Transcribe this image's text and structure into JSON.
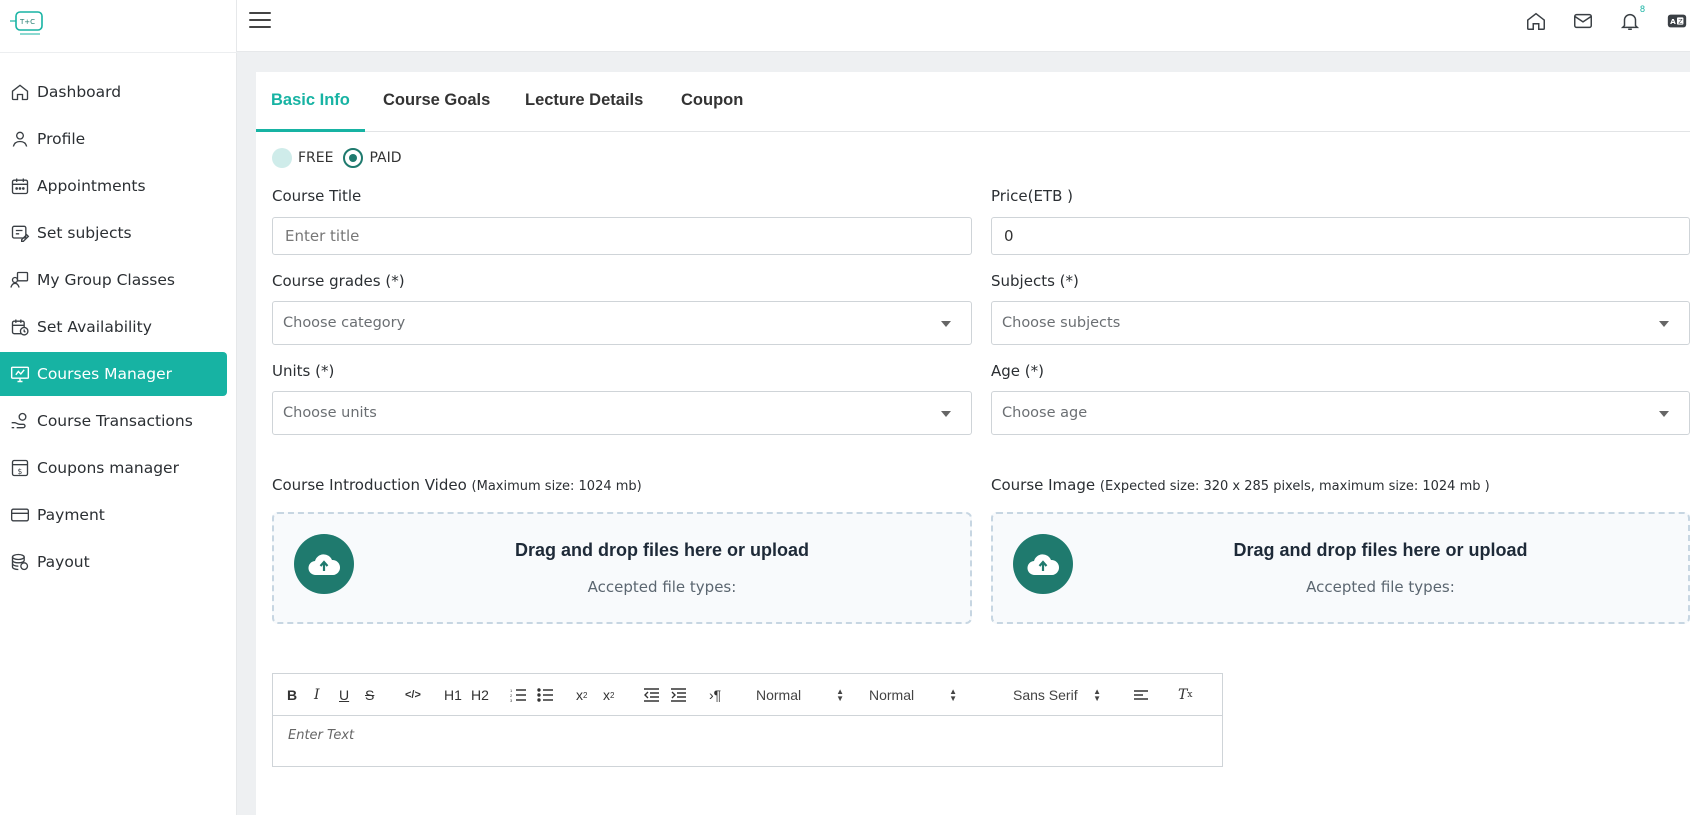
{
  "nav": {
    "items": [
      {
        "label": "Dashboard",
        "icon": "home-icon"
      },
      {
        "label": "Profile",
        "icon": "user-icon"
      },
      {
        "label": "Appointments",
        "icon": "calendar-icon"
      },
      {
        "label": "Set subjects",
        "icon": "subjects-icon"
      },
      {
        "label": "My Group Classes",
        "icon": "group-class-icon"
      },
      {
        "label": "Set Availability",
        "icon": "calendar-clock-icon"
      },
      {
        "label": "Courses Manager",
        "icon": "presentation-icon",
        "active": true
      },
      {
        "label": "Course Transactions",
        "icon": "hand-coin-icon"
      },
      {
        "label": "Coupons manager",
        "icon": "coupon-icon"
      },
      {
        "label": "Payment",
        "icon": "card-icon"
      },
      {
        "label": "Payout",
        "icon": "coins-icon"
      }
    ]
  },
  "topbar": {
    "notification_count": "8"
  },
  "tabs": [
    "Basic Info",
    "Course Goals",
    "Lecture Details",
    "Coupon"
  ],
  "pricing": {
    "free_label": "FREE",
    "paid_label": "PAID",
    "selected": "PAID"
  },
  "form": {
    "course_title_label": "Course Title",
    "course_title_placeholder": "Enter title",
    "price_label": "Price(ETB )",
    "price_value": "0",
    "grades_label": "Course grades (*)",
    "grades_placeholder": "Choose category",
    "subjects_label": "Subjects (*)",
    "subjects_placeholder": "Choose subjects",
    "units_label": "Units (*)",
    "units_placeholder": "Choose units",
    "age_label": "Age (*)",
    "age_placeholder": "Choose age",
    "video_label": "Course Introduction Video",
    "video_hint": "(Maximum size: 1024 mb)",
    "image_label": "Course Image",
    "image_hint": "(Expected size: 320 x 285 pixels, maximum size: 1024 mb )",
    "dropzone_title": "Drag and drop files here or upload",
    "dropzone_sub": "Accepted file types:"
  },
  "editor": {
    "header_select": "Normal",
    "size_select": "Normal",
    "font_select": "Sans Serif",
    "placeholder": "Enter Text",
    "h1": "H1",
    "h2": "H2"
  },
  "colors": {
    "accent": "#17b3a3",
    "dark_teal": "#1f7a6e"
  }
}
